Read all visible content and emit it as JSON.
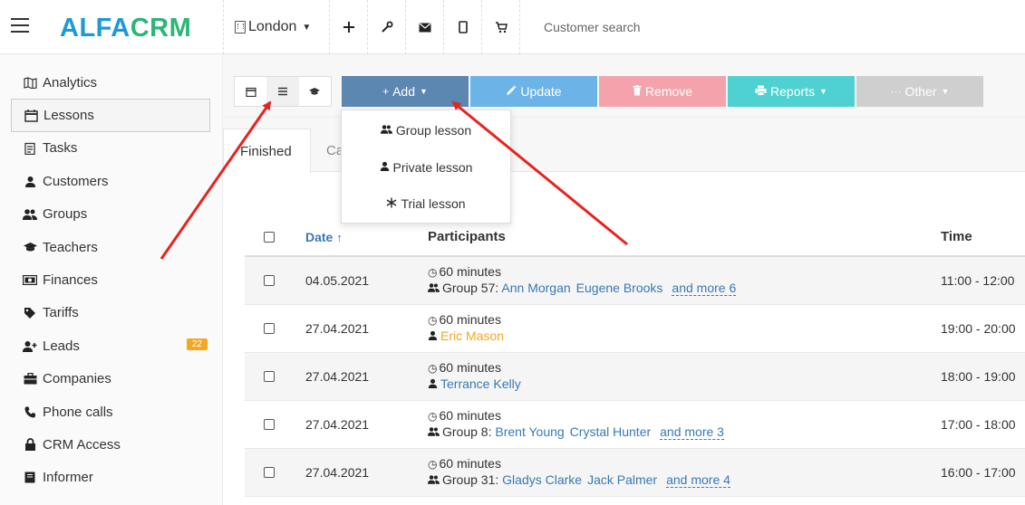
{
  "header": {
    "logo_part1": "ALFA",
    "logo_part2": "CRM",
    "branch": "London",
    "search_placeholder": "Customer search"
  },
  "sidebar": {
    "items": [
      {
        "label": "Analytics",
        "icon": "map-icon"
      },
      {
        "label": "Lessons",
        "icon": "calendar-icon"
      },
      {
        "label": "Tasks",
        "icon": "clipboard-icon"
      },
      {
        "label": "Customers",
        "icon": "user-icon"
      },
      {
        "label": "Groups",
        "icon": "users-icon"
      },
      {
        "label": "Teachers",
        "icon": "graduation-cap-icon"
      },
      {
        "label": "Finances",
        "icon": "money-icon"
      },
      {
        "label": "Tariffs",
        "icon": "tag-icon"
      },
      {
        "label": "Leads",
        "icon": "user-plus-icon",
        "badge": "22"
      },
      {
        "label": "Companies",
        "icon": "briefcase-icon"
      },
      {
        "label": "Phone calls",
        "icon": "phone-icon"
      },
      {
        "label": "CRM Access",
        "icon": "lock-icon"
      },
      {
        "label": "Informer",
        "icon": "book-icon"
      }
    ]
  },
  "toolbar": {
    "add": "Add",
    "update": "Update",
    "remove": "Remove",
    "reports": "Reports",
    "other": "Other",
    "colors": {
      "add": "#5b87b1",
      "update": "#6cb4e8",
      "remove": "#f4a3ad",
      "reports": "#4fd1d1",
      "other": "#cfcfcf"
    }
  },
  "add_menu": {
    "group_lesson": "Group lesson",
    "private_lesson": "Private lesson",
    "trial_lesson": "Trial lesson"
  },
  "tabs": {
    "finished": "Finished",
    "other_partial": "Ca"
  },
  "table": {
    "col_date": "Date",
    "col_date_sort": "↑",
    "col_participants": "Participants",
    "col_time": "Time",
    "rows": [
      {
        "date": "04.05.2021",
        "duration": "60 minutes",
        "group": "Group 57:",
        "names": [
          "Ann Morgan",
          "Eugene Brooks"
        ],
        "more": "and more 6",
        "time": "11:00 - 12:00",
        "private": false
      },
      {
        "date": "27.04.2021",
        "duration": "60 minutes",
        "group": "",
        "names": [
          "Eric Mason"
        ],
        "more": "",
        "time": "19:00 - 20:00",
        "private": true,
        "orange": true
      },
      {
        "date": "27.04.2021",
        "duration": "60 minutes",
        "group": "",
        "names": [
          "Terrance Kelly"
        ],
        "more": "",
        "time": "18:00 - 19:00",
        "private": true
      },
      {
        "date": "27.04.2021",
        "duration": "60 minutes",
        "group": "Group 8:",
        "names": [
          "Brent Young",
          "Crystal Hunter"
        ],
        "more": "and more 3",
        "time": "17:00 - 18:00",
        "private": false
      },
      {
        "date": "27.04.2021",
        "duration": "60 minutes",
        "group": "Group 31:",
        "names": [
          "Gladys Clarke",
          "Jack Palmer"
        ],
        "more": "and more 4",
        "time": "16:00 - 17:00",
        "private": false
      }
    ]
  },
  "annotation_arrow_color": "#e8231f"
}
